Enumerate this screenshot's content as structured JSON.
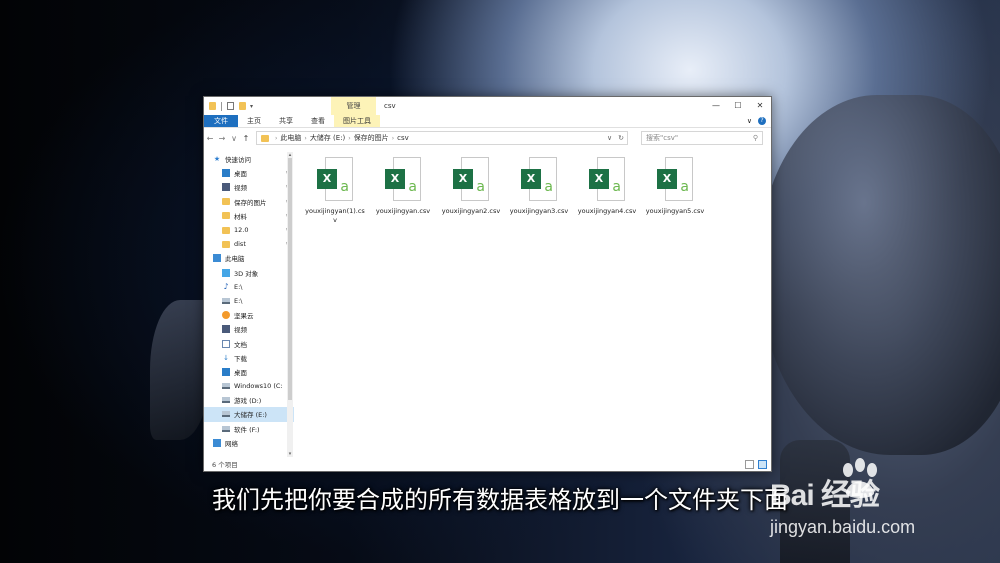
{
  "window": {
    "title": "csv",
    "context_tab_group": "管理",
    "controls": {
      "minimize": "—",
      "maximize": "☐",
      "close": "✕"
    }
  },
  "ribbon": {
    "tabs": [
      "文件",
      "主页",
      "共享",
      "查看",
      "图片工具"
    ],
    "collapse": "∨",
    "help": "?"
  },
  "address": {
    "back": "←",
    "forward": "→",
    "recent": "∨",
    "up": "↑",
    "crumbs": [
      "此电脑",
      "大储存 (E:)",
      "保存的图片",
      "csv"
    ],
    "dropdown": "∨",
    "refresh": "↻",
    "search_placeholder": "搜索\"csv\"",
    "search_icon": "⚲"
  },
  "sidebar": {
    "items": [
      {
        "label": "快速访问",
        "icon": "star-icon"
      },
      {
        "label": "桌面",
        "icon": "desktop-icon",
        "pinned": true
      },
      {
        "label": "视频",
        "icon": "video-icon",
        "pinned": true
      },
      {
        "label": "保存的图片",
        "icon": "folder-icon",
        "pinned": true
      },
      {
        "label": "材料",
        "icon": "folder-icon",
        "pinned": true
      },
      {
        "label": "12.0",
        "icon": "folder-icon",
        "pinned": true
      },
      {
        "label": "dist",
        "icon": "folder-icon",
        "pinned": true
      },
      {
        "label": "此电脑",
        "icon": "pc-icon"
      },
      {
        "label": "3D 对象",
        "icon": "cube-icon"
      },
      {
        "label": "E:\\",
        "icon": "music-icon"
      },
      {
        "label": "E:\\",
        "icon": "drive-icon"
      },
      {
        "label": "坚果云",
        "icon": "cloud-icon"
      },
      {
        "label": "视频",
        "icon": "video-icon"
      },
      {
        "label": "文档",
        "icon": "document-icon"
      },
      {
        "label": "下载",
        "icon": "download-icon"
      },
      {
        "label": "桌面",
        "icon": "desktop-icon"
      },
      {
        "label": "Windows10 (C:",
        "icon": "drive-icon"
      },
      {
        "label": "游戏 (D:)",
        "icon": "drive-icon"
      },
      {
        "label": "大储存 (E:)",
        "icon": "drive-icon",
        "selected": true
      },
      {
        "label": "软件 (F:)",
        "icon": "drive-icon"
      },
      {
        "label": "网络",
        "icon": "network-icon"
      }
    ],
    "pin_glyph": "✱"
  },
  "files": [
    {
      "name": "youxijingyan(1).csv"
    },
    {
      "name": "youxijingyan.csv"
    },
    {
      "name": "youxijingyan2.csv"
    },
    {
      "name": "youxijingyan3.csv"
    },
    {
      "name": "youxijingyan4.csv"
    },
    {
      "name": "youxijingyan5.csv"
    }
  ],
  "file_icon": {
    "badge": "X",
    "glyph": "a"
  },
  "status": {
    "count": "6 个项目"
  },
  "subtitle": "我们先把你要合成的所有数据表格放到一个文件夹下面",
  "watermark": {
    "logo": "Bai 经验",
    "url": "jingyan.baidu.com"
  },
  "colors": {
    "accent": "#1e6fbf",
    "context_tab": "#fdf3b8",
    "excel_green": "#1d7145",
    "selection": "#cce4f7"
  }
}
